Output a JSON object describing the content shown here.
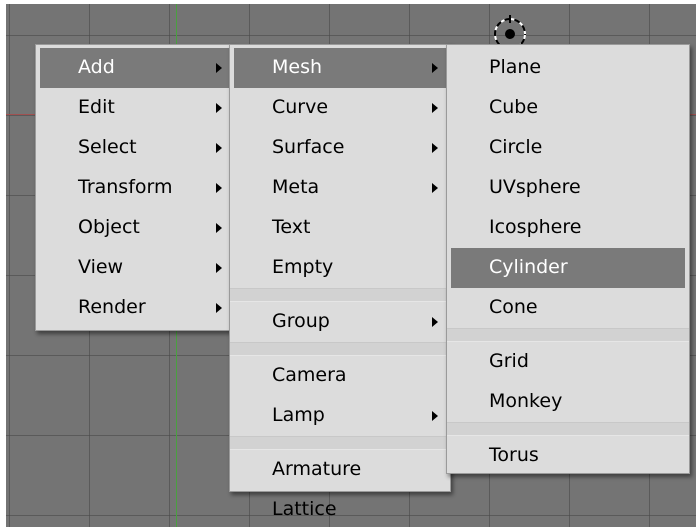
{
  "main_menu": {
    "items": [
      {
        "label": "Add",
        "has_submenu": true,
        "highlighted": true
      },
      {
        "label": "Edit",
        "has_submenu": true
      },
      {
        "label": "Select",
        "has_submenu": true
      },
      {
        "label": "Transform",
        "has_submenu": true
      },
      {
        "label": "Object",
        "has_submenu": true
      },
      {
        "label": "View",
        "has_submenu": true
      },
      {
        "label": "Render",
        "has_submenu": true
      }
    ]
  },
  "add_menu": {
    "items": [
      {
        "label": "Mesh",
        "has_submenu": true,
        "highlighted": true
      },
      {
        "label": "Curve",
        "has_submenu": true
      },
      {
        "label": "Surface",
        "has_submenu": true
      },
      {
        "label": "Meta",
        "has_submenu": true
      },
      {
        "label": "Text"
      },
      {
        "label": "Empty"
      },
      {
        "separator": true
      },
      {
        "label": "Group",
        "has_submenu": true
      },
      {
        "separator": true
      },
      {
        "label": "Camera"
      },
      {
        "label": "Lamp",
        "has_submenu": true
      },
      {
        "separator": true
      },
      {
        "label": "Armature"
      },
      {
        "label": "Lattice"
      }
    ]
  },
  "mesh_menu": {
    "items": [
      {
        "label": "Plane"
      },
      {
        "label": "Cube"
      },
      {
        "label": "Circle"
      },
      {
        "label": "UVsphere"
      },
      {
        "label": "Icosphere"
      },
      {
        "label": "Cylinder",
        "highlighted": true
      },
      {
        "label": "Cone"
      },
      {
        "separator": true
      },
      {
        "label": "Grid"
      },
      {
        "label": "Monkey"
      },
      {
        "separator": true
      },
      {
        "label": "Torus"
      }
    ]
  },
  "colors": {
    "viewport_background": "#747474",
    "menu_background": "#dcdcdc",
    "highlight": "#7a7a7a",
    "x_axis": "#a05050",
    "y_axis": "#4aa040"
  },
  "icons": {
    "submenu_arrow": "triangle-right",
    "cursor": "3d-cursor"
  }
}
